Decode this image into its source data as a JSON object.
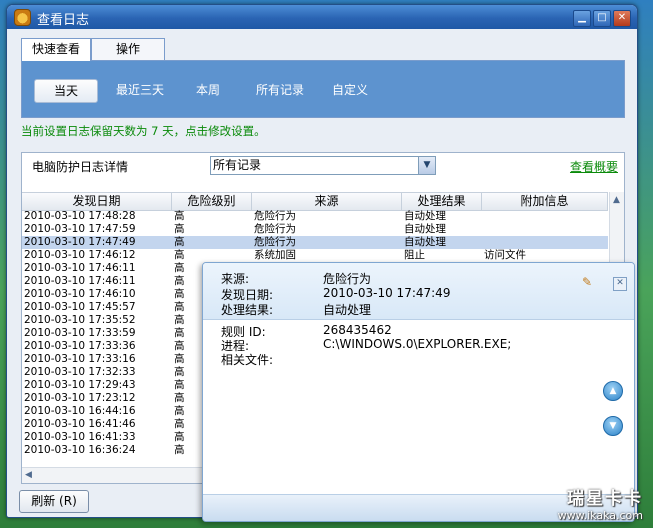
{
  "window": {
    "title": "查看日志"
  },
  "tabs": [
    {
      "label": "快速查看",
      "active": true
    },
    {
      "label": "操作",
      "active": false
    }
  ],
  "ranges": [
    {
      "label": "当天",
      "active": true
    },
    {
      "label": "最近三天",
      "active": false
    },
    {
      "label": "本周",
      "active": false
    },
    {
      "label": "所有记录",
      "active": false
    },
    {
      "label": "自定义",
      "active": false
    }
  ],
  "notice": "当前设置日志保留天数为 7 天，点击修改设置。",
  "log_panel": {
    "title": "电脑防护日志详情",
    "filter_value": "所有记录",
    "overview_link": "查看概要"
  },
  "table": {
    "columns": [
      "发现日期",
      "危险级别",
      "来源",
      "处理结果",
      "附加信息"
    ],
    "rows": [
      [
        "2010-03-10 17:48:28",
        "高",
        "危险行为",
        "自动处理",
        ""
      ],
      [
        "2010-03-10 17:47:59",
        "高",
        "危险行为",
        "自动处理",
        ""
      ],
      [
        "2010-03-10 17:47:49",
        "高",
        "危险行为",
        "自动处理",
        ""
      ],
      [
        "2010-03-10 17:46:12",
        "高",
        "系统加固",
        "阻止",
        "访问文件"
      ],
      [
        "2010-03-10 17:46:11",
        "高",
        "系统加固",
        "阻止",
        "访问文件"
      ],
      [
        "2010-03-10 17:46:11",
        "高",
        "",
        "",
        ""
      ],
      [
        "2010-03-10 17:46:10",
        "高",
        "",
        "",
        ""
      ],
      [
        "2010-03-10 17:45:57",
        "高",
        "",
        "",
        ""
      ],
      [
        "2010-03-10 17:35:52",
        "高",
        "",
        "",
        ""
      ],
      [
        "2010-03-10 17:33:59",
        "高",
        "",
        "",
        ""
      ],
      [
        "2010-03-10 17:33:36",
        "高",
        "",
        "",
        ""
      ],
      [
        "2010-03-10 17:33:16",
        "高",
        "",
        "",
        ""
      ],
      [
        "2010-03-10 17:32:33",
        "高",
        "",
        "",
        ""
      ],
      [
        "2010-03-10 17:29:43",
        "高",
        "",
        "",
        ""
      ],
      [
        "2010-03-10 17:23:12",
        "高",
        "",
        "",
        ""
      ],
      [
        "2010-03-10 16:44:16",
        "高",
        "",
        "",
        ""
      ],
      [
        "2010-03-10 16:41:46",
        "高",
        "",
        "",
        ""
      ],
      [
        "2010-03-10 16:41:33",
        "高",
        "",
        "",
        ""
      ],
      [
        "2010-03-10 16:36:24",
        "高",
        "",
        "",
        ""
      ]
    ],
    "selected_index": 2
  },
  "refresh_button": "刷新 (R)",
  "detail_popup": {
    "source_label": "来源:",
    "source_value": "危险行为",
    "date_label": "发现日期:",
    "date_value": "2010-03-10 17:47:49",
    "result_label": "处理结果:",
    "result_value": "自动处理",
    "rule_label": "规则 ID:",
    "rule_value": "268435462",
    "process_label": "进程:",
    "process_value": "C:\\WINDOWS.0\\EXPLORER.EXE;",
    "file_label": "相关文件:"
  },
  "watermark": {
    "brand": "瑞星卡卡",
    "url": "www.ikaka.com"
  }
}
